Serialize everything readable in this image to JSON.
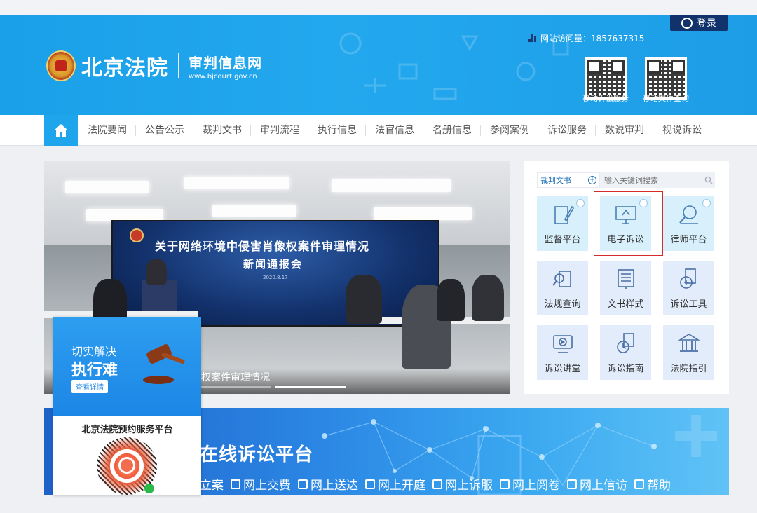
{
  "header": {
    "site_name": "北京法院",
    "subtitle": "审判信息网",
    "url": "www.bjcourt.gov.cn",
    "visits_label": "网站访问量：",
    "visits_count": "1857637315",
    "login_label": "登录",
    "qr_codes": [
      {
        "label": "移动诉讼服务"
      },
      {
        "label": "移动案件查询"
      }
    ]
  },
  "nav": {
    "home_icon": "home-icon",
    "items": [
      "法院要闻",
      "公告公示",
      "裁判文书",
      "审判流程",
      "执行信息",
      "法官信息",
      "名册信息",
      "参阅案例",
      "诉讼服务",
      "数说审判",
      "视说诉讼"
    ]
  },
  "photo": {
    "screen_title": "关于网络环境中侵害肖像权案件审理情况",
    "screen_subtitle": "新闻通报会",
    "screen_date": "2020.8.17",
    "caption": "权案件审理情况"
  },
  "services": {
    "search_category": "裁判文书",
    "search_placeholder": "输入关键词搜索",
    "tiles": [
      {
        "label": "监督平台",
        "icon": "pen-paper-icon"
      },
      {
        "label": "电子诉讼",
        "icon": "monitor-icon"
      },
      {
        "label": "律师平台",
        "icon": "magnifier-person-icon"
      },
      {
        "label": "法规查询",
        "icon": "search-doc-icon"
      },
      {
        "label": "文书样式",
        "icon": "book-icon"
      },
      {
        "label": "诉讼工具",
        "icon": "calculator-icon"
      },
      {
        "label": "诉讼讲堂",
        "icon": "video-icon"
      },
      {
        "label": "诉讼指南",
        "icon": "compass-doc-icon"
      },
      {
        "label": "法院指引",
        "icon": "court-building-icon"
      }
    ]
  },
  "banner": {
    "title": "在线诉讼平台",
    "links": [
      "立案",
      "网上交费",
      "网上送达",
      "网上开庭",
      "网上诉服",
      "网上阅卷",
      "网上信访",
      "帮助"
    ]
  },
  "ad": {
    "line1": "切实解决",
    "line2": "执行难",
    "button": "查看详情",
    "platform_title": "北京法院预约服务平台"
  },
  "colors": {
    "header_blue": "#1aa0e8",
    "login_navy": "#12326b",
    "highlight_red": "#d62b2b",
    "tile_cyan": "#d8f0fb"
  }
}
